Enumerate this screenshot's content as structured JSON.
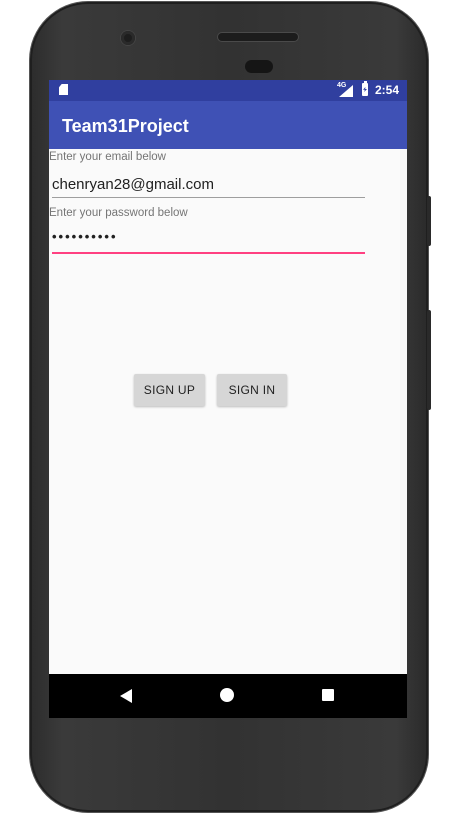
{
  "status_bar": {
    "network_label": "4G",
    "time": "2:54"
  },
  "app_bar": {
    "title": "Team31Project"
  },
  "form": {
    "email_label": "Enter your email below",
    "email_value": "chenryan28@gmail.com",
    "password_label": "Enter your password below",
    "password_value": "••••••••••"
  },
  "buttons": {
    "sign_up": "SIGN UP",
    "sign_in": "SIGN IN"
  },
  "colors": {
    "status_bar": "#303f9f",
    "app_bar": "#3f51b5",
    "accent": "#ff4081",
    "button": "#d6d6d6"
  },
  "icons": {
    "status_left": "sd-card-icon",
    "status_signal": "signal-icon",
    "status_battery": "battery-charging-icon",
    "nav": [
      "back-icon",
      "home-icon",
      "recents-icon"
    ]
  }
}
